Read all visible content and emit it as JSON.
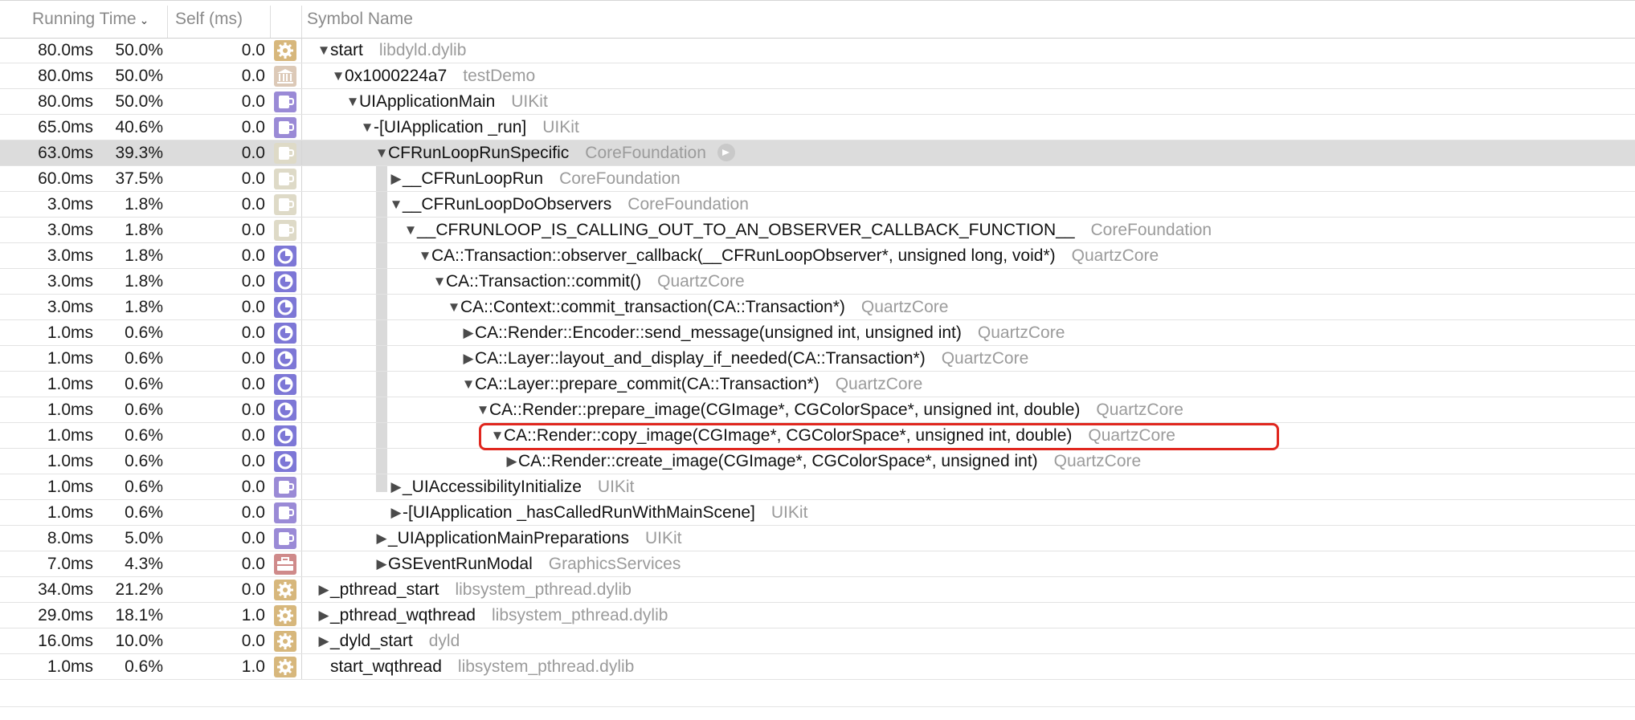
{
  "header": {
    "running_time": "Running Time",
    "self_ms": "Self (ms)",
    "symbol_name": "Symbol Name"
  },
  "rows": [
    {
      "ms": "80.0ms",
      "pct": "50.0%",
      "self": "0.0",
      "icon": "gear-icon",
      "level": 0,
      "disclosure": "open",
      "name": "start",
      "lib": "libdyld.dylib"
    },
    {
      "ms": "80.0ms",
      "pct": "50.0%",
      "self": "0.0",
      "icon": "museum-icon",
      "level": 1,
      "disclosure": "open",
      "name": "0x1000224a7",
      "lib": "testDemo"
    },
    {
      "ms": "80.0ms",
      "pct": "50.0%",
      "self": "0.0",
      "icon": "cup-icon",
      "level": 2,
      "disclosure": "open",
      "name": "UIApplicationMain",
      "lib": "UIKit"
    },
    {
      "ms": "65.0ms",
      "pct": "40.6%",
      "self": "0.0",
      "icon": "cup-icon",
      "level": 3,
      "disclosure": "open",
      "name": "-[UIApplication _run]",
      "lib": "UIKit"
    },
    {
      "ms": "63.0ms",
      "pct": "39.3%",
      "self": "0.0",
      "icon": "cup-light-icon",
      "level": 4,
      "disclosure": "open",
      "name": "CFRunLoopRunSpecific",
      "lib": "CoreFoundation",
      "selected": true
    },
    {
      "ms": "60.0ms",
      "pct": "37.5%",
      "self": "0.0",
      "icon": "cup-light-icon",
      "level": 5,
      "disclosure": "closed",
      "name": "__CFRunLoopRun",
      "lib": "CoreFoundation"
    },
    {
      "ms": "3.0ms",
      "pct": "1.8%",
      "self": "0.0",
      "icon": "cup-light-icon",
      "level": 5,
      "disclosure": "open",
      "name": "__CFRunLoopDoObservers",
      "lib": "CoreFoundation"
    },
    {
      "ms": "3.0ms",
      "pct": "1.8%",
      "self": "0.0",
      "icon": "cup-light-icon",
      "level": 6,
      "disclosure": "open",
      "name": "__CFRUNLOOP_IS_CALLING_OUT_TO_AN_OBSERVER_CALLBACK_FUNCTION__",
      "lib": "CoreFoundation"
    },
    {
      "ms": "3.0ms",
      "pct": "1.8%",
      "self": "0.0",
      "icon": "pie-icon",
      "level": 7,
      "disclosure": "open",
      "name": "CA::Transaction::observer_callback(__CFRunLoopObserver*, unsigned long, void*)",
      "lib": "QuartzCore"
    },
    {
      "ms": "3.0ms",
      "pct": "1.8%",
      "self": "0.0",
      "icon": "pie-icon",
      "level": 8,
      "disclosure": "open",
      "name": "CA::Transaction::commit()",
      "lib": "QuartzCore"
    },
    {
      "ms": "3.0ms",
      "pct": "1.8%",
      "self": "0.0",
      "icon": "pie-icon",
      "level": 9,
      "disclosure": "open",
      "name": "CA::Context::commit_transaction(CA::Transaction*)",
      "lib": "QuartzCore"
    },
    {
      "ms": "1.0ms",
      "pct": "0.6%",
      "self": "0.0",
      "icon": "pie-icon",
      "level": 10,
      "disclosure": "closed",
      "name": "CA::Render::Encoder::send_message(unsigned int, unsigned int)",
      "lib": "QuartzCore"
    },
    {
      "ms": "1.0ms",
      "pct": "0.6%",
      "self": "0.0",
      "icon": "pie-icon",
      "level": 10,
      "disclosure": "closed",
      "name": "CA::Layer::layout_and_display_if_needed(CA::Transaction*)",
      "lib": "QuartzCore"
    },
    {
      "ms": "1.0ms",
      "pct": "0.6%",
      "self": "0.0",
      "icon": "pie-icon",
      "level": 10,
      "disclosure": "open",
      "name": "CA::Layer::prepare_commit(CA::Transaction*)",
      "lib": "QuartzCore"
    },
    {
      "ms": "1.0ms",
      "pct": "0.6%",
      "self": "0.0",
      "icon": "pie-icon",
      "level": 11,
      "disclosure": "open",
      "name": "CA::Render::prepare_image(CGImage*, CGColorSpace*, unsigned int, double)",
      "lib": "QuartzCore"
    },
    {
      "ms": "1.0ms",
      "pct": "0.6%",
      "self": "0.0",
      "icon": "pie-icon",
      "level": 12,
      "disclosure": "open",
      "name": "CA::Render::copy_image(CGImage*, CGColorSpace*, unsigned int, double)",
      "lib": "QuartzCore"
    },
    {
      "ms": "1.0ms",
      "pct": "0.6%",
      "self": "0.0",
      "icon": "pie-icon",
      "level": 13,
      "disclosure": "closed",
      "name": "CA::Render::create_image(CGImage*, CGColorSpace*, unsigned int)",
      "lib": "QuartzCore"
    },
    {
      "ms": "1.0ms",
      "pct": "0.6%",
      "self": "0.0",
      "icon": "cup-icon",
      "level": 5,
      "disclosure": "closed",
      "name": "_UIAccessibilityInitialize",
      "lib": "UIKit"
    },
    {
      "ms": "1.0ms",
      "pct": "0.6%",
      "self": "0.0",
      "icon": "cup-icon",
      "level": 5,
      "disclosure": "closed",
      "name": "-[UIApplication _hasCalledRunWithMainScene]",
      "lib": "UIKit"
    },
    {
      "ms": "8.0ms",
      "pct": "5.0%",
      "self": "0.0",
      "icon": "cup-icon",
      "level": 4,
      "disclosure": "closed",
      "name": "_UIApplicationMainPreparations",
      "lib": "UIKit"
    },
    {
      "ms": "7.0ms",
      "pct": "4.3%",
      "self": "0.0",
      "icon": "toolbox-icon",
      "level": 4,
      "disclosure": "closed",
      "name": "GSEventRunModal",
      "lib": "GraphicsServices"
    },
    {
      "ms": "34.0ms",
      "pct": "21.2%",
      "self": "0.0",
      "icon": "gear-icon",
      "level": 0,
      "disclosure": "closed",
      "name": "_pthread_start",
      "lib": "libsystem_pthread.dylib"
    },
    {
      "ms": "29.0ms",
      "pct": "18.1%",
      "self": "1.0",
      "icon": "gear-icon",
      "level": 0,
      "disclosure": "closed",
      "name": "_pthread_wqthread",
      "lib": "libsystem_pthread.dylib"
    },
    {
      "ms": "16.0ms",
      "pct": "10.0%",
      "self": "0.0",
      "icon": "gear-icon",
      "level": 0,
      "disclosure": "closed",
      "name": "_dyld_start",
      "lib": "dyld"
    },
    {
      "ms": "1.0ms",
      "pct": "0.6%",
      "self": "1.0",
      "icon": "gear-icon",
      "level": 0,
      "disclosure": "none",
      "name": "start_wqthread",
      "lib": "libsystem_pthread.dylib"
    }
  ]
}
